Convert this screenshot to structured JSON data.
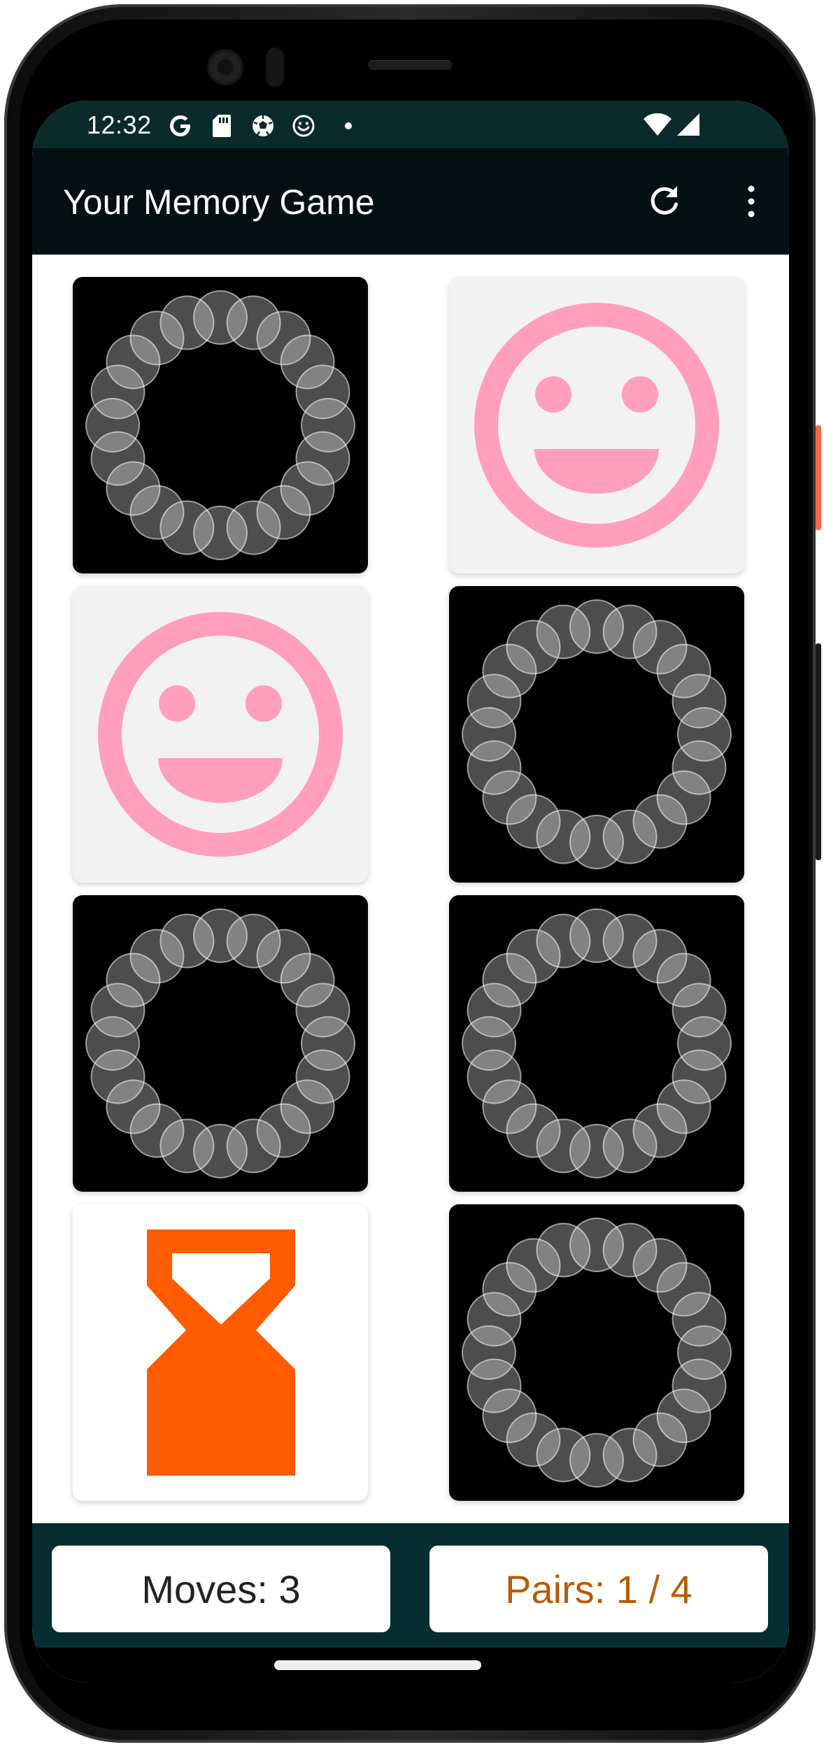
{
  "status_bar": {
    "time": "12:32",
    "left_icons": [
      "google-g-icon",
      "sd-card-icon",
      "soccer-ball-icon",
      "smiley-face-icon",
      "dot-icon"
    ],
    "right_icons": [
      "wifi-icon",
      "cell-signal-icon"
    ]
  },
  "app_bar": {
    "title": "Your Memory Game",
    "actions": [
      "refresh-icon",
      "more-vert-icon"
    ]
  },
  "board": {
    "columns": 2,
    "rows": 4,
    "cards": [
      {
        "state": "face-down",
        "face": "ring-of-circles"
      },
      {
        "state": "face-up",
        "face": "smiley"
      },
      {
        "state": "face-up",
        "face": "smiley"
      },
      {
        "state": "face-down",
        "face": "ring-of-circles"
      },
      {
        "state": "face-down",
        "face": "ring-of-circles"
      },
      {
        "state": "face-down",
        "face": "ring-of-circles"
      },
      {
        "state": "face-up",
        "face": "hourglass"
      },
      {
        "state": "face-down",
        "face": "ring-of-circles"
      }
    ]
  },
  "stats": {
    "moves_label": "Moves: 3",
    "pairs_label": "Pairs: 1 / 4"
  },
  "colors": {
    "status_bar": "#0b2a2c",
    "app_bar": "#041011",
    "bottom_bar": "#062e30",
    "card_back": "#000000",
    "smiley_pink": "#ff9fbd",
    "hourglass_orange": "#ff5b00",
    "pairs_text": "#b85b00"
  }
}
